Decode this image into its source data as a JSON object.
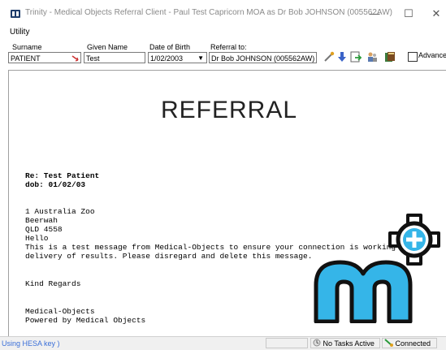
{
  "window": {
    "title": "Trinity - Medical Objects Referral Client  - Paul Test Capricorn MOA as Dr Bob JOHNSON (005562AW)",
    "minimize_glyph": "—",
    "maximize_glyph": "☐",
    "close_glyph": "✕"
  },
  "menu": {
    "items": [
      {
        "label": "Utility"
      }
    ]
  },
  "form": {
    "surname_label": "Surname",
    "given_name_label": "Given Name",
    "dob_label": "Date of Birth",
    "referral_to_label": "Referral to:",
    "surname_value": "PATIENT",
    "given_name_value": "Test",
    "dob_value": "1/02/2003",
    "referral_to_value": "Dr Bob JOHNSON (005562AW)",
    "advanced_label": "Advanced"
  },
  "toolbar": {
    "icons": [
      "edit-wand-icon",
      "download-arrow-icon",
      "export-icon",
      "users-icon",
      "book-icon"
    ]
  },
  "document": {
    "heading": "REFERRAL",
    "re_line": "Re: Test Patient",
    "dob_line": "dob: 01/02/03",
    "body_lines": [
      "1 Australia Zoo",
      "Beerwah",
      "QLD 4558",
      "Hello",
      "This is a test message from Medical-Objects to ensure your connection is working for",
      "delivery of results. Please disregard and delete this message."
    ],
    "regards": "Kind Regards",
    "signature_lines": [
      "Medical-Objects",
      "Powered by Medical Objects"
    ]
  },
  "statusbar": {
    "left_text": "Using HESA key )",
    "tasks_text": "No Tasks Active",
    "connection_text": "Connected"
  },
  "colors": {
    "brand_blue": "#35b5e8",
    "link_blue": "#3a6fd8",
    "logo_dark": "#1a1a1a"
  }
}
